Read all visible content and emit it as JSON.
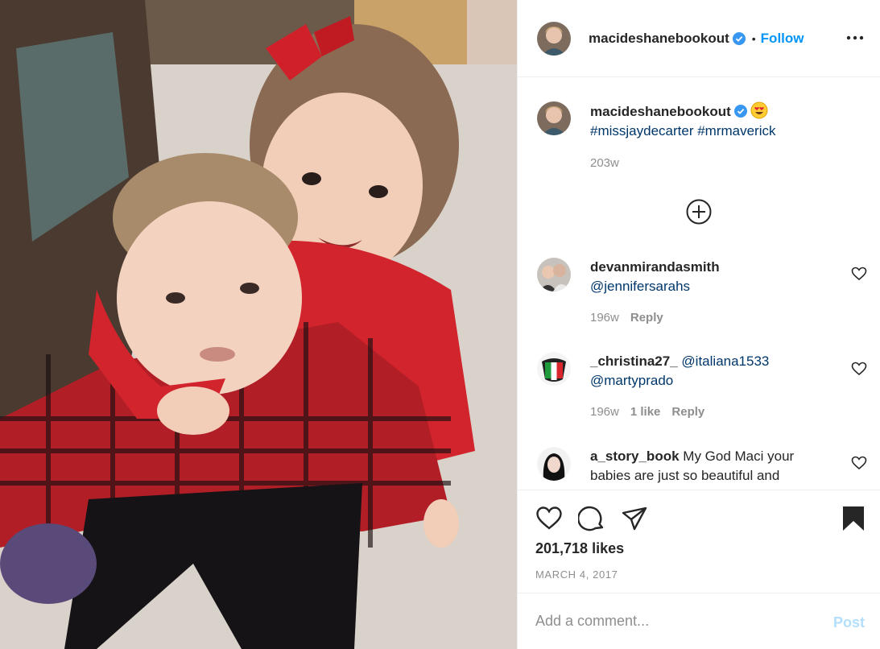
{
  "post": {
    "author": "macideshanebookout",
    "follow_label": "Follow",
    "separator": "•",
    "caption": {
      "username": "macideshanebookout",
      "hashtags": "#missjaydecarter #mrmaverick",
      "age": "203w"
    },
    "comments": [
      {
        "username": "devanmirandasmith",
        "text": "@jennifersarahs",
        "age": "196w",
        "reply_label": "Reply"
      },
      {
        "username": "_christina27_",
        "mention": "@italiana1533",
        "text": "@martyprado",
        "age": "196w",
        "likes": "1 like",
        "reply_label": "Reply"
      },
      {
        "username": "a_story_book",
        "text": "My God Maci your babies are just so beautiful and",
        "age": "",
        "reply_label": ""
      }
    ],
    "likes": "201,718 likes",
    "date": "MARCH 4, 2017",
    "add_comment_placeholder": "Add a comment...",
    "post_label": "Post"
  },
  "icons": {
    "verified": "verified-badge-icon",
    "more": "more-options-icon",
    "load_more": "load-more-comments-icon",
    "like": "heart-icon",
    "comment": "comment-icon",
    "share": "share-icon",
    "save": "bookmark-icon"
  },
  "colors": {
    "link": "#0095f6",
    "hashtag": "#00376b",
    "muted": "#8e8e8e",
    "post_disabled": "#b2dffc"
  }
}
